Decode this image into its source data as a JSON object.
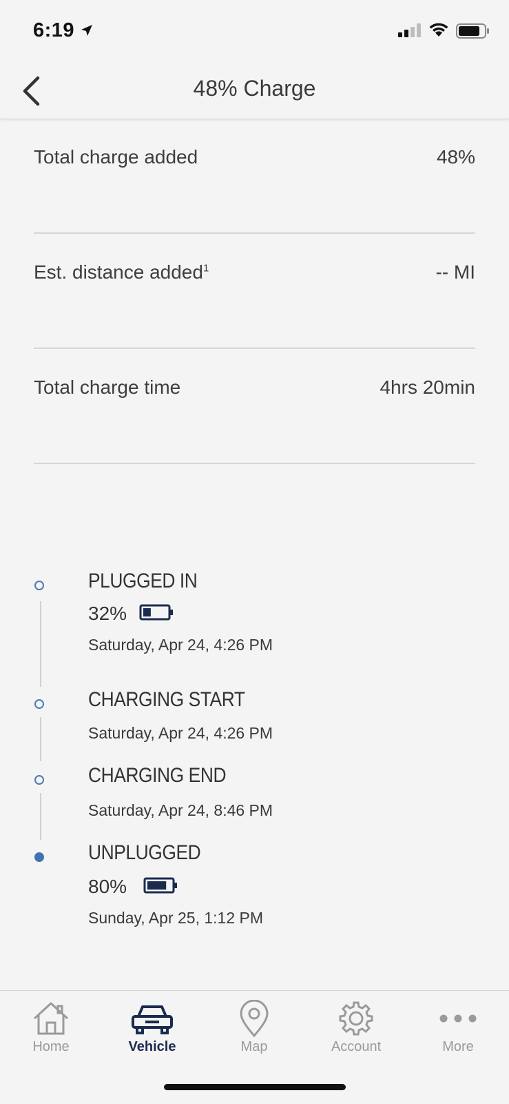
{
  "status_bar": {
    "time": "6:19"
  },
  "header": {
    "title": "48% Charge"
  },
  "stats": [
    {
      "label": "Total charge added",
      "value": "48%"
    },
    {
      "label": "Est. distance added",
      "label_sup": "1",
      "value": "-- MI"
    },
    {
      "label": "Total charge time",
      "value": "4hrs 20min"
    }
  ],
  "timeline": [
    {
      "title": "PLUGGED IN",
      "percent": "32%",
      "battery_level": 0.32,
      "date": "Saturday, Apr 24, 4:26 PM",
      "status": "complete"
    },
    {
      "title": "CHARGING START",
      "date": "Saturday, Apr 24, 4:26 PM",
      "status": "complete"
    },
    {
      "title": "CHARGING END",
      "date": "Saturday, Apr 24, 8:46 PM",
      "status": "complete"
    },
    {
      "title": "UNPLUGGED",
      "percent": "80%",
      "battery_level": 0.8,
      "date": "Sunday, Apr 25, 1:12 PM",
      "status": "current"
    }
  ],
  "tab_bar": {
    "tabs": [
      {
        "label": "Home",
        "icon": "home-icon"
      },
      {
        "label": "Vehicle",
        "icon": "vehicle-icon",
        "active": true
      },
      {
        "label": "Map",
        "icon": "map-pin-icon"
      },
      {
        "label": "Account",
        "icon": "gear-icon"
      },
      {
        "label": "More",
        "icon": "more-icon"
      }
    ]
  },
  "colors": {
    "accent": "#1a2b4e",
    "timeline_dot": "#3f73b1",
    "inactive_tab": "#9a9a9a"
  }
}
